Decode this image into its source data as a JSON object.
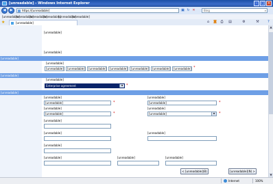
{
  "window": {
    "title": "[unreadable] - Windows Internet Explorer"
  },
  "nav": {
    "url": "https://[unreadable]",
    "search_placeholder": "Bing",
    "back_icon": "back-arrow-icon",
    "forward_icon": "forward-arrow-icon",
    "lock_icon": "lock-icon",
    "refresh_icon": "refresh-icon",
    "stop_icon": "stop-icon"
  },
  "menu": {
    "items": [
      "[unreadable]",
      "[unreadable]",
      "[unreadable]",
      "[unreadable]",
      "[unreadable]",
      "[unreadable]"
    ]
  },
  "tab": {
    "title": "[unreadable]"
  },
  "main": {
    "intro": "[unreadable]",
    "required_note": "[unreadable]"
  },
  "sections": {
    "product_info": "[unreadable]",
    "license_program": "[unreadable]",
    "company_info": "[unreadable]"
  },
  "license": {
    "code_label": "[unreadable]",
    "codes": [
      "[unreadable]",
      "[unreadable]",
      "[unreadable]",
      "[unreadable]",
      "[unreadable]",
      "[unreadable]",
      "[unreadable]"
    ],
    "program_label": "[unreadable]",
    "program_value": "Enterprise agreement"
  },
  "company": {
    "last_name_label": "[unreadable]",
    "last_name_value": "[unreadable]",
    "first_name_label": "[unreadable]",
    "first_name_value": "[unreadable]",
    "company_label": "[unreadable]",
    "company_value": "[unreadable]",
    "country_label": "[unreadable]",
    "country_value": "[unreadable]",
    "org_unit_label": "[unreadable]",
    "email_label": "[unreadable]",
    "phone_label": "[unreadable]",
    "address_label": "[unreadable]",
    "city_label": "[unreadable]",
    "state_label": "[unreadable]",
    "postal_label": "[unreadable]"
  },
  "buttons": {
    "back": "< [unreadable](B)",
    "next": "[unreadable](N) >"
  },
  "status": {
    "zone": "Internet",
    "zoom": "100%"
  },
  "colors": {
    "accent": "#6e9fe6",
    "titlebar": "#2350a0",
    "required": "#d20000"
  }
}
